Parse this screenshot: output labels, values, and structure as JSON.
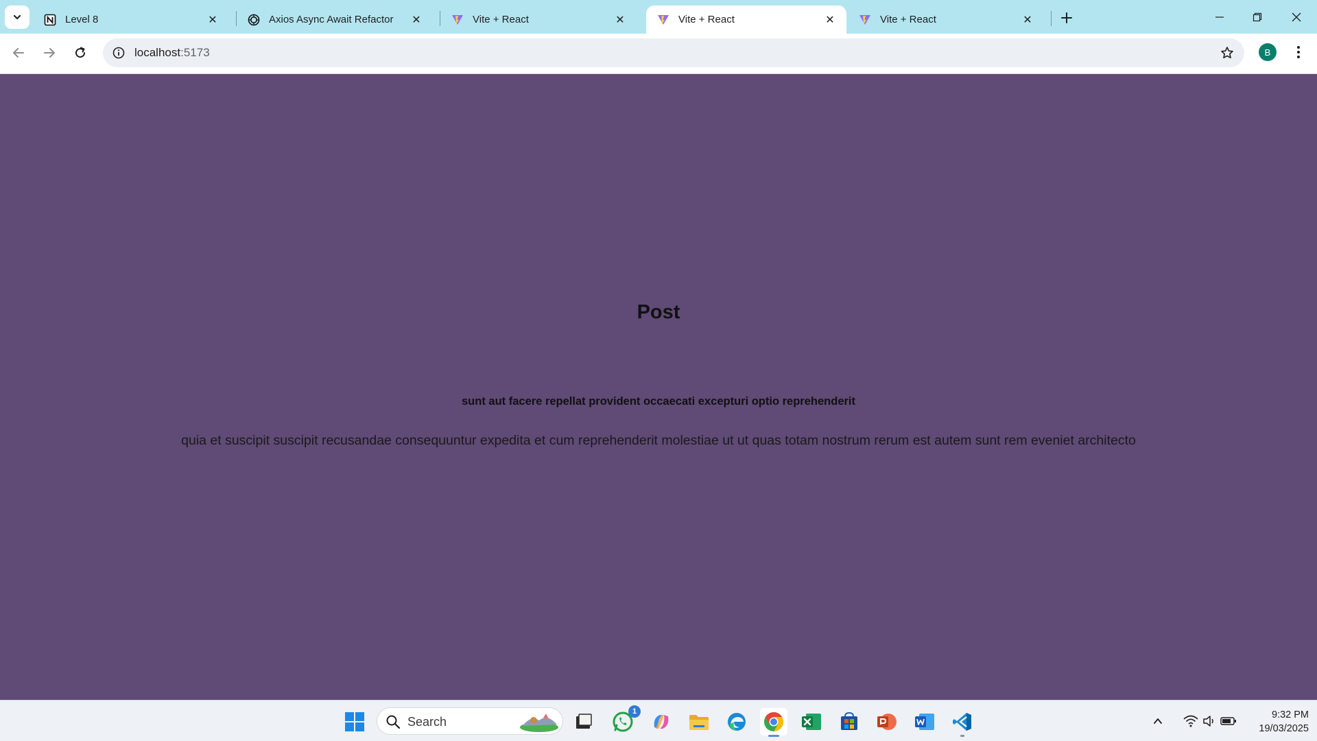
{
  "browser": {
    "tabs": [
      {
        "title": "Level 8",
        "favicon": "notion-icon"
      },
      {
        "title": "Axios Async Await Refactor",
        "favicon": "openai-icon"
      },
      {
        "title": "Vite + React",
        "favicon": "vite-icon"
      },
      {
        "title": "Vite + React",
        "favicon": "vite-icon",
        "active": true
      },
      {
        "title": "Vite + React",
        "favicon": "vite-icon"
      }
    ],
    "address": {
      "host": "localhost",
      "port": ":5173"
    },
    "profile_initial": "B"
  },
  "page": {
    "heading": "Post",
    "post_title": "sunt aut facere repellat provident occaecati excepturi optio reprehenderit",
    "post_body": "quia et suscipit suscipit recusandae consequuntur expedita et cum reprehenderit molestiae ut ut quas totam nostrum rerum est autem sunt rem eveniet architecto",
    "background_color": "#604a76"
  },
  "taskbar": {
    "search_label": "Search",
    "whatsapp_badge": "1",
    "clock_time": "9:32 PM",
    "clock_date": "19/03/2025"
  }
}
